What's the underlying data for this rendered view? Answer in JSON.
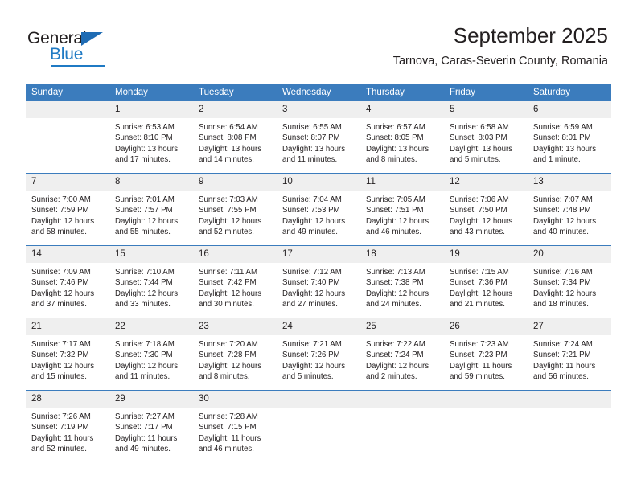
{
  "brand": {
    "name_top": "General",
    "name_bottom": "Blue",
    "accent_color": "#1f7ac4",
    "triangle_color": "#1f6cb4"
  },
  "header": {
    "title": "September 2025",
    "subtitle": "Tarnova, Caras-Severin County, Romania"
  },
  "theme": {
    "header_band": "#3b7cbd",
    "date_band": "#efefef",
    "separator": "#3b7cbd",
    "text": "#231f20",
    "background": "#ffffff"
  },
  "weekday_headers": [
    "Sunday",
    "Monday",
    "Tuesday",
    "Wednesday",
    "Thursday",
    "Friday",
    "Saturday"
  ],
  "weeks": [
    [
      {
        "day": "",
        "blank": true,
        "sunrise": "",
        "sunset": "",
        "daylight_line1": "",
        "daylight_line2": ""
      },
      {
        "day": "1",
        "sunrise": "Sunrise: 6:53 AM",
        "sunset": "Sunset: 8:10 PM",
        "daylight_line1": "Daylight: 13 hours",
        "daylight_line2": "and 17 minutes."
      },
      {
        "day": "2",
        "sunrise": "Sunrise: 6:54 AM",
        "sunset": "Sunset: 8:08 PM",
        "daylight_line1": "Daylight: 13 hours",
        "daylight_line2": "and 14 minutes."
      },
      {
        "day": "3",
        "sunrise": "Sunrise: 6:55 AM",
        "sunset": "Sunset: 8:07 PM",
        "daylight_line1": "Daylight: 13 hours",
        "daylight_line2": "and 11 minutes."
      },
      {
        "day": "4",
        "sunrise": "Sunrise: 6:57 AM",
        "sunset": "Sunset: 8:05 PM",
        "daylight_line1": "Daylight: 13 hours",
        "daylight_line2": "and 8 minutes."
      },
      {
        "day": "5",
        "sunrise": "Sunrise: 6:58 AM",
        "sunset": "Sunset: 8:03 PM",
        "daylight_line1": "Daylight: 13 hours",
        "daylight_line2": "and 5 minutes."
      },
      {
        "day": "6",
        "sunrise": "Sunrise: 6:59 AM",
        "sunset": "Sunset: 8:01 PM",
        "daylight_line1": "Daylight: 13 hours",
        "daylight_line2": "and 1 minute."
      }
    ],
    [
      {
        "day": "7",
        "sunrise": "Sunrise: 7:00 AM",
        "sunset": "Sunset: 7:59 PM",
        "daylight_line1": "Daylight: 12 hours",
        "daylight_line2": "and 58 minutes."
      },
      {
        "day": "8",
        "sunrise": "Sunrise: 7:01 AM",
        "sunset": "Sunset: 7:57 PM",
        "daylight_line1": "Daylight: 12 hours",
        "daylight_line2": "and 55 minutes."
      },
      {
        "day": "9",
        "sunrise": "Sunrise: 7:03 AM",
        "sunset": "Sunset: 7:55 PM",
        "daylight_line1": "Daylight: 12 hours",
        "daylight_line2": "and 52 minutes."
      },
      {
        "day": "10",
        "sunrise": "Sunrise: 7:04 AM",
        "sunset": "Sunset: 7:53 PM",
        "daylight_line1": "Daylight: 12 hours",
        "daylight_line2": "and 49 minutes."
      },
      {
        "day": "11",
        "sunrise": "Sunrise: 7:05 AM",
        "sunset": "Sunset: 7:51 PM",
        "daylight_line1": "Daylight: 12 hours",
        "daylight_line2": "and 46 minutes."
      },
      {
        "day": "12",
        "sunrise": "Sunrise: 7:06 AM",
        "sunset": "Sunset: 7:50 PM",
        "daylight_line1": "Daylight: 12 hours",
        "daylight_line2": "and 43 minutes."
      },
      {
        "day": "13",
        "sunrise": "Sunrise: 7:07 AM",
        "sunset": "Sunset: 7:48 PM",
        "daylight_line1": "Daylight: 12 hours",
        "daylight_line2": "and 40 minutes."
      }
    ],
    [
      {
        "day": "14",
        "sunrise": "Sunrise: 7:09 AM",
        "sunset": "Sunset: 7:46 PM",
        "daylight_line1": "Daylight: 12 hours",
        "daylight_line2": "and 37 minutes."
      },
      {
        "day": "15",
        "sunrise": "Sunrise: 7:10 AM",
        "sunset": "Sunset: 7:44 PM",
        "daylight_line1": "Daylight: 12 hours",
        "daylight_line2": "and 33 minutes."
      },
      {
        "day": "16",
        "sunrise": "Sunrise: 7:11 AM",
        "sunset": "Sunset: 7:42 PM",
        "daylight_line1": "Daylight: 12 hours",
        "daylight_line2": "and 30 minutes."
      },
      {
        "day": "17",
        "sunrise": "Sunrise: 7:12 AM",
        "sunset": "Sunset: 7:40 PM",
        "daylight_line1": "Daylight: 12 hours",
        "daylight_line2": "and 27 minutes."
      },
      {
        "day": "18",
        "sunrise": "Sunrise: 7:13 AM",
        "sunset": "Sunset: 7:38 PM",
        "daylight_line1": "Daylight: 12 hours",
        "daylight_line2": "and 24 minutes."
      },
      {
        "day": "19",
        "sunrise": "Sunrise: 7:15 AM",
        "sunset": "Sunset: 7:36 PM",
        "daylight_line1": "Daylight: 12 hours",
        "daylight_line2": "and 21 minutes."
      },
      {
        "day": "20",
        "sunrise": "Sunrise: 7:16 AM",
        "sunset": "Sunset: 7:34 PM",
        "daylight_line1": "Daylight: 12 hours",
        "daylight_line2": "and 18 minutes."
      }
    ],
    [
      {
        "day": "21",
        "sunrise": "Sunrise: 7:17 AM",
        "sunset": "Sunset: 7:32 PM",
        "daylight_line1": "Daylight: 12 hours",
        "daylight_line2": "and 15 minutes."
      },
      {
        "day": "22",
        "sunrise": "Sunrise: 7:18 AM",
        "sunset": "Sunset: 7:30 PM",
        "daylight_line1": "Daylight: 12 hours",
        "daylight_line2": "and 11 minutes."
      },
      {
        "day": "23",
        "sunrise": "Sunrise: 7:20 AM",
        "sunset": "Sunset: 7:28 PM",
        "daylight_line1": "Daylight: 12 hours",
        "daylight_line2": "and 8 minutes."
      },
      {
        "day": "24",
        "sunrise": "Sunrise: 7:21 AM",
        "sunset": "Sunset: 7:26 PM",
        "daylight_line1": "Daylight: 12 hours",
        "daylight_line2": "and 5 minutes."
      },
      {
        "day": "25",
        "sunrise": "Sunrise: 7:22 AM",
        "sunset": "Sunset: 7:24 PM",
        "daylight_line1": "Daylight: 12 hours",
        "daylight_line2": "and 2 minutes."
      },
      {
        "day": "26",
        "sunrise": "Sunrise: 7:23 AM",
        "sunset": "Sunset: 7:23 PM",
        "daylight_line1": "Daylight: 11 hours",
        "daylight_line2": "and 59 minutes."
      },
      {
        "day": "27",
        "sunrise": "Sunrise: 7:24 AM",
        "sunset": "Sunset: 7:21 PM",
        "daylight_line1": "Daylight: 11 hours",
        "daylight_line2": "and 56 minutes."
      }
    ],
    [
      {
        "day": "28",
        "sunrise": "Sunrise: 7:26 AM",
        "sunset": "Sunset: 7:19 PM",
        "daylight_line1": "Daylight: 11 hours",
        "daylight_line2": "and 52 minutes."
      },
      {
        "day": "29",
        "sunrise": "Sunrise: 7:27 AM",
        "sunset": "Sunset: 7:17 PM",
        "daylight_line1": "Daylight: 11 hours",
        "daylight_line2": "and 49 minutes."
      },
      {
        "day": "30",
        "sunrise": "Sunrise: 7:28 AM",
        "sunset": "Sunset: 7:15 PM",
        "daylight_line1": "Daylight: 11 hours",
        "daylight_line2": "and 46 minutes."
      },
      {
        "day": "",
        "blank": true,
        "sunrise": "",
        "sunset": "",
        "daylight_line1": "",
        "daylight_line2": ""
      },
      {
        "day": "",
        "blank": true,
        "sunrise": "",
        "sunset": "",
        "daylight_line1": "",
        "daylight_line2": ""
      },
      {
        "day": "",
        "blank": true,
        "sunrise": "",
        "sunset": "",
        "daylight_line1": "",
        "daylight_line2": ""
      },
      {
        "day": "",
        "blank": true,
        "sunrise": "",
        "sunset": "",
        "daylight_line1": "",
        "daylight_line2": ""
      }
    ]
  ]
}
